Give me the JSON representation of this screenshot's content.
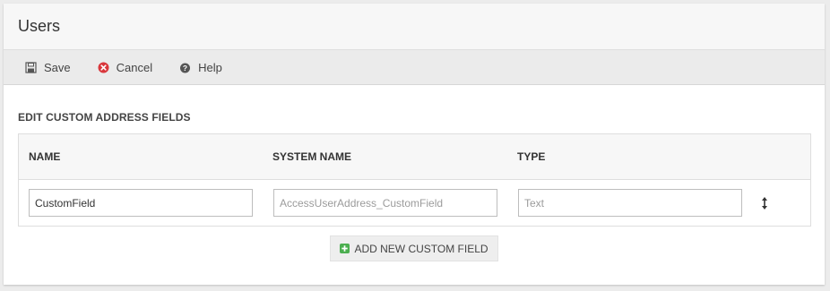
{
  "header": {
    "title": "Users"
  },
  "toolbar": {
    "save_label": "Save",
    "cancel_label": "Cancel",
    "help_label": "Help"
  },
  "section": {
    "title": "EDIT CUSTOM ADDRESS FIELDS"
  },
  "table": {
    "columns": [
      "NAME",
      "SYSTEM NAME",
      "TYPE"
    ],
    "rows": [
      {
        "name": "CustomField",
        "system_name": "AccessUserAddress_CustomField",
        "type": "Text"
      }
    ]
  },
  "add_button": {
    "label": "ADD NEW CUSTOM FIELD"
  },
  "colors": {
    "cancel_red": "#d9373c",
    "add_green": "#4caf50",
    "header_bg": "#f7f7f7",
    "toolbar_bg": "#ebebeb"
  }
}
